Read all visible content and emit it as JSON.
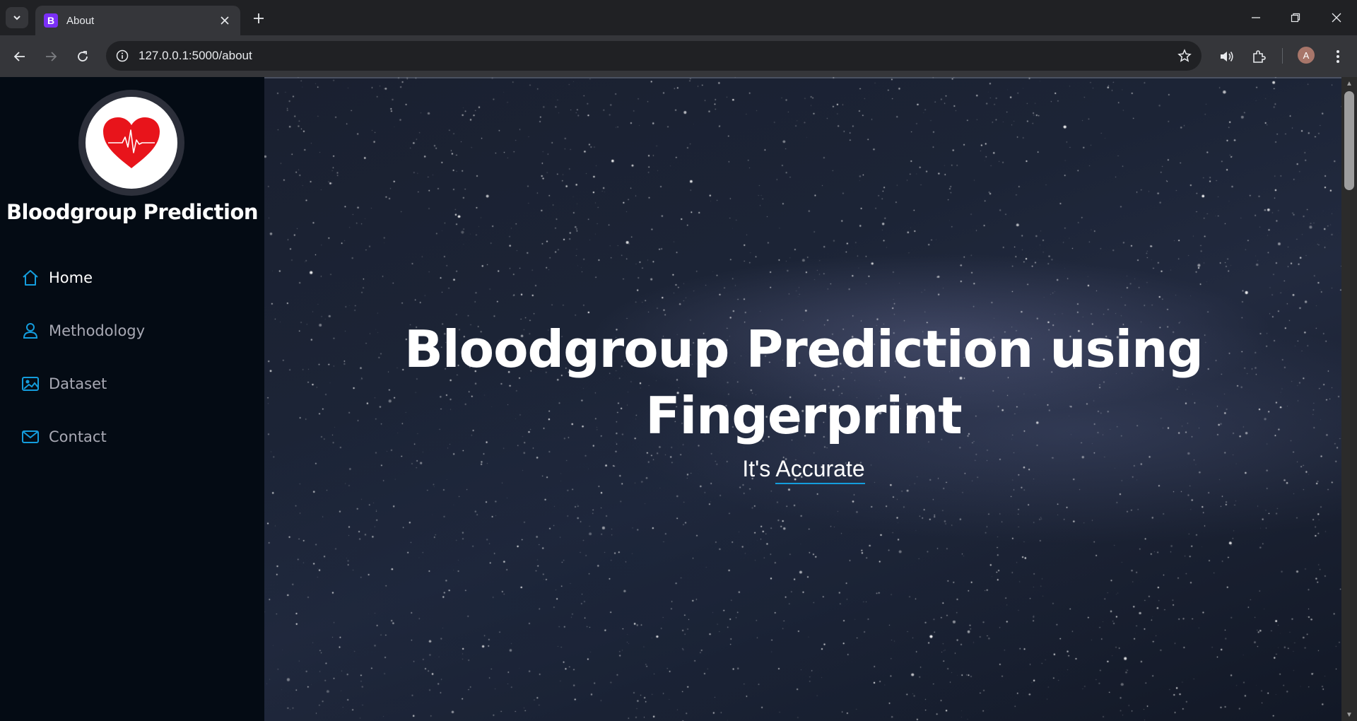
{
  "browser": {
    "tab_title": "About",
    "tab_favicon_letter": "B",
    "url": "127.0.0.1:5000/about",
    "profile_initial": "A"
  },
  "sidebar": {
    "site_title": "Bloodgroup Prediction",
    "logo_icon": "heart-pulse-icon",
    "nav_items": [
      {
        "label": "Home",
        "icon": "home-icon",
        "active": true
      },
      {
        "label": "Methodology",
        "icon": "person-icon",
        "active": false
      },
      {
        "label": "Dataset",
        "icon": "image-icon",
        "active": false
      },
      {
        "label": "Contact",
        "icon": "envelope-icon",
        "active": false
      }
    ]
  },
  "hero": {
    "title_line1": "Bloodgroup Prediction using",
    "title_line2": "Fingerprint",
    "subtitle_prefix": "It's",
    "subtitle_typed": "Accurate"
  },
  "colors": {
    "accent": "#149ddd",
    "sidebar_bg": "#040b14",
    "heart": "#e8141b"
  }
}
